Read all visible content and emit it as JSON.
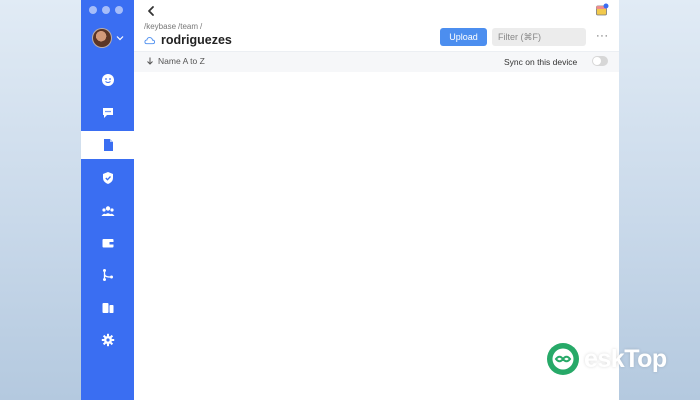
{
  "breadcrumb": [
    "/keybase",
    "/team",
    "/"
  ],
  "folder": {
    "title": "rodriguezes"
  },
  "actions": {
    "upload_label": "Upload",
    "filter_placeholder": "Filter (⌘F)",
    "more_label": "···"
  },
  "toolbar": {
    "sort_label": "Name A to Z",
    "sync_label": "Sync on this device",
    "sync_enabled": false
  },
  "sidebar": {
    "items": [
      {
        "icon": "people-icon"
      },
      {
        "icon": "chat-icon"
      },
      {
        "icon": "file-icon",
        "active": true
      },
      {
        "icon": "shield-icon"
      },
      {
        "icon": "team-icon"
      },
      {
        "icon": "wallet-icon"
      },
      {
        "icon": "git-icon"
      },
      {
        "icon": "devices-icon"
      },
      {
        "icon": "gear-icon"
      }
    ]
  },
  "watermark": {
    "text": "eskTop"
  },
  "colors": {
    "sidebar": "#3a6ef2",
    "upload": "#4c8eef"
  }
}
